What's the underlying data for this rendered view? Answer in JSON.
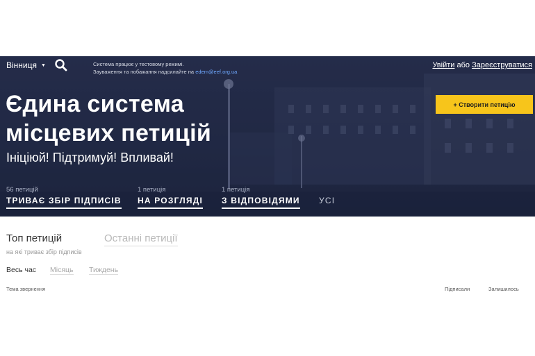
{
  "header": {
    "city": "Вінниця",
    "notice_line1": "Система працює у тестовому режимі.",
    "notice_line2_prefix": "Зауваження та побажання надсилайте на",
    "notice_email": "edem@eef.org.ua",
    "login_label": "Увійти",
    "or_label": "або",
    "register_label": "Зареєструватися",
    "create_label": "+ Створити петицію"
  },
  "hero": {
    "title_line1": "Єдина система",
    "title_line2": "місцевих петицій",
    "slogan": "Ініціюй! Підтримуй! Впливай!"
  },
  "stats": [
    {
      "count": "56 петицій",
      "label": "ТРИВАЄ ЗБІР ПІДПИСІВ"
    },
    {
      "count": "1 петиція",
      "label": "НА РОЗГЛЯДІ"
    },
    {
      "count": "1 петиція",
      "label": "З ВІДПОВІДЯМИ"
    },
    {
      "count": "",
      "label": "УСІ"
    }
  ],
  "petitions": {
    "tab_top": "Топ петицій",
    "tab_top_sub": "на які триває збір підписів",
    "tab_recent": "Останні петиції",
    "periods": [
      "Весь час",
      "Місяць",
      "Тиждень"
    ],
    "columns": [
      "Тема звернення",
      "Підписали",
      "Залишилось"
    ]
  },
  "colors": {
    "hero_bg": "#262f4d",
    "accent": "#f7c51b",
    "email_link": "#6fa8ff"
  }
}
